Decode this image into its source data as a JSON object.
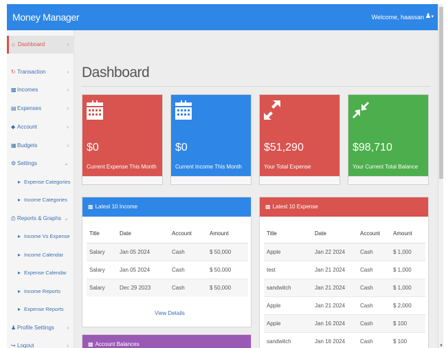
{
  "header": {
    "brand": "Money Manager",
    "welcome": "Welcome, haassan",
    "user_icon": "user-icon"
  },
  "sidebar": {
    "items": [
      {
        "label": "Dashboard",
        "icon": "home-icon"
      },
      {
        "label": "Transaction",
        "icon": "refresh-icon"
      },
      {
        "label": "Incomes",
        "icon": "bar-chart-icon"
      },
      {
        "label": "Expenses",
        "icon": "list-icon"
      },
      {
        "label": "Account",
        "icon": "tag-icon"
      },
      {
        "label": "Budgets",
        "icon": "grid-icon"
      },
      {
        "label": "Settings",
        "icon": "gear-icon"
      },
      {
        "label": "Expense Categories",
        "icon": "caret-icon"
      },
      {
        "label": "Income Categories",
        "icon": "caret-icon"
      },
      {
        "label": "Reports & Graphs",
        "icon": "print-icon"
      },
      {
        "label": "Income Vs Expense",
        "icon": "caret-icon"
      },
      {
        "label": "Income Calendar",
        "icon": "caret-icon"
      },
      {
        "label": "Expense Calendar",
        "icon": "caret-icon"
      },
      {
        "label": "Income Reports",
        "icon": "caret-icon"
      },
      {
        "label": "Expense Reports",
        "icon": "caret-icon"
      },
      {
        "label": "Profile Settings",
        "icon": "user-icon"
      },
      {
        "label": "Logout",
        "icon": "logout-icon"
      }
    ]
  },
  "page": {
    "title": "Dashboard"
  },
  "stats": [
    {
      "amount": "$0",
      "label": "Current Expense This Month",
      "color": "#d9534f",
      "icon": "calendar-icon"
    },
    {
      "amount": "$0",
      "label": "Current Income This Month",
      "color": "#2e86e6",
      "icon": "calendar-icon"
    },
    {
      "amount": "$51,290",
      "label": "Your Total Expense",
      "color": "#d9534f",
      "icon": "expand-arrows-icon"
    },
    {
      "amount": "$98,710",
      "label": "Your Current Total Balance",
      "color": "#4cae4c",
      "icon": "compress-arrows-icon"
    }
  ],
  "income_panel": {
    "title": "Latest 10 Income",
    "color": "#2e86e6",
    "columns": [
      "Title",
      "Date",
      "Account",
      "Amount"
    ],
    "rows": [
      [
        "Salary",
        "Jan 05 2024",
        "Cash",
        "$ 50,000"
      ],
      [
        "Salary",
        "Jan 05 2024",
        "Cash",
        "$ 50,000"
      ],
      [
        "Salary",
        "Dec 29 2023",
        "Cash",
        "$ 50,000"
      ]
    ],
    "view_details": "View Details"
  },
  "expense_panel": {
    "title": "Latest 10 Expense",
    "color": "#d9534f",
    "columns": [
      "Title",
      "Date",
      "Account",
      "Amount"
    ],
    "rows": [
      [
        "Apple",
        "Jan 22 2024",
        "Cash",
        "$ 1,000"
      ],
      [
        "test",
        "Jan 21 2024",
        "Cash",
        "$ 1,000"
      ],
      [
        "sandwitch",
        "Jan 21 2024",
        "Cash",
        "$ 1,000"
      ],
      [
        "Apple",
        "Jan 21 2024",
        "Cash",
        "$ 2,000"
      ],
      [
        "Apple",
        "Jan 16 2024",
        "Cash",
        "$ 100"
      ],
      [
        "sandwitch",
        "Jan 16 2024",
        "Cash",
        "$ 100"
      ]
    ]
  },
  "balances_panel": {
    "title": "Account Balances",
    "color": "#9b59b6"
  }
}
